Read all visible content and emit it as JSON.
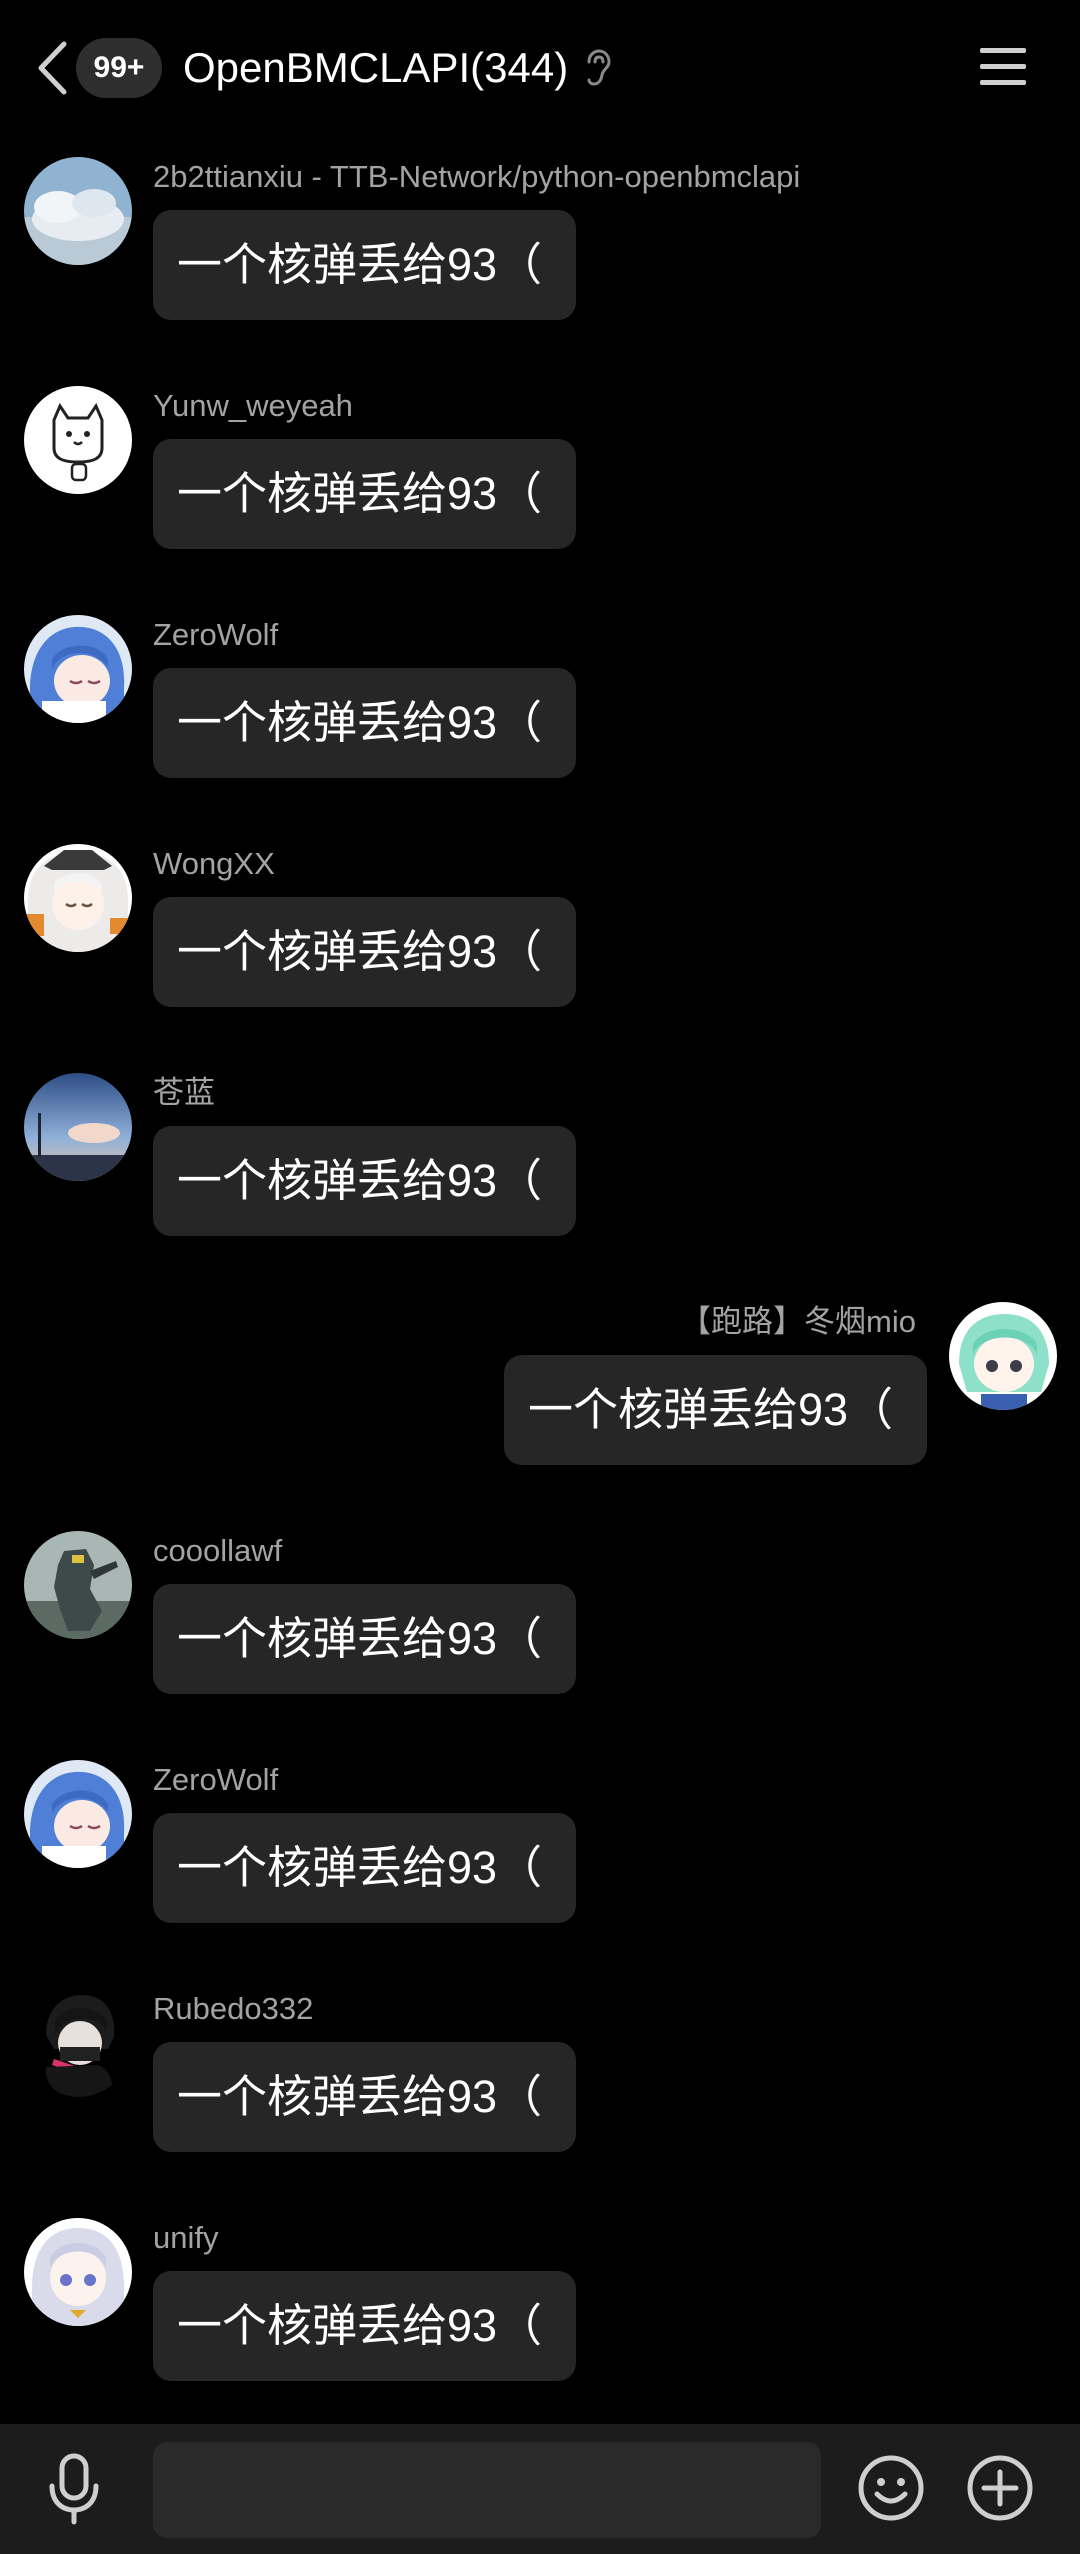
{
  "header": {
    "unread_count": "99+",
    "title": "OpenBMCLAPI(344)"
  },
  "messages": [
    {
      "sender": "2b2ttianxiu - TTB-Network/python-openbmclapi",
      "text": "一个核弹丢给93（",
      "side": "left",
      "avatar": "sky-avatar"
    },
    {
      "sender": "Yunw_weyeah",
      "text": "一个核弹丢给93（",
      "side": "left",
      "avatar": "cat-avatar"
    },
    {
      "sender": "ZeroWolf",
      "text": "一个核弹丢给93（",
      "side": "left",
      "avatar": "anime-blue-hair-avatar"
    },
    {
      "sender": "WongXX",
      "text": "一个核弹丢给93（",
      "side": "left",
      "avatar": "anime-white-hair-avatar"
    },
    {
      "sender": "苍蓝",
      "text": "一个核弹丢给93（",
      "side": "left",
      "avatar": "sunset-sky-avatar"
    },
    {
      "sender": "【跑路】冬烟mio",
      "text": "一个核弹丢给93（",
      "side": "right",
      "avatar": "anime-green-hair-avatar"
    },
    {
      "sender": "cooollawf",
      "text": "一个核弹丢给93（",
      "side": "left",
      "avatar": "mech-robot-avatar"
    },
    {
      "sender": "ZeroWolf",
      "text": "一个核弹丢给93（",
      "side": "left",
      "avatar": "anime-blue-hair-avatar"
    },
    {
      "sender": "Rubedo332",
      "text": "一个核弹丢给93（",
      "side": "left",
      "avatar": "dark-anime-avatar"
    },
    {
      "sender": "unify",
      "text": "一个核弹丢给93（",
      "side": "left",
      "avatar": "anime-silver-hair-avatar"
    }
  ],
  "input": {
    "placeholder": ""
  },
  "colors": {
    "background": "#000000",
    "bubble": "#262626",
    "sender_text": "#a3a3a3",
    "input_bar": "#1c1c1c"
  }
}
